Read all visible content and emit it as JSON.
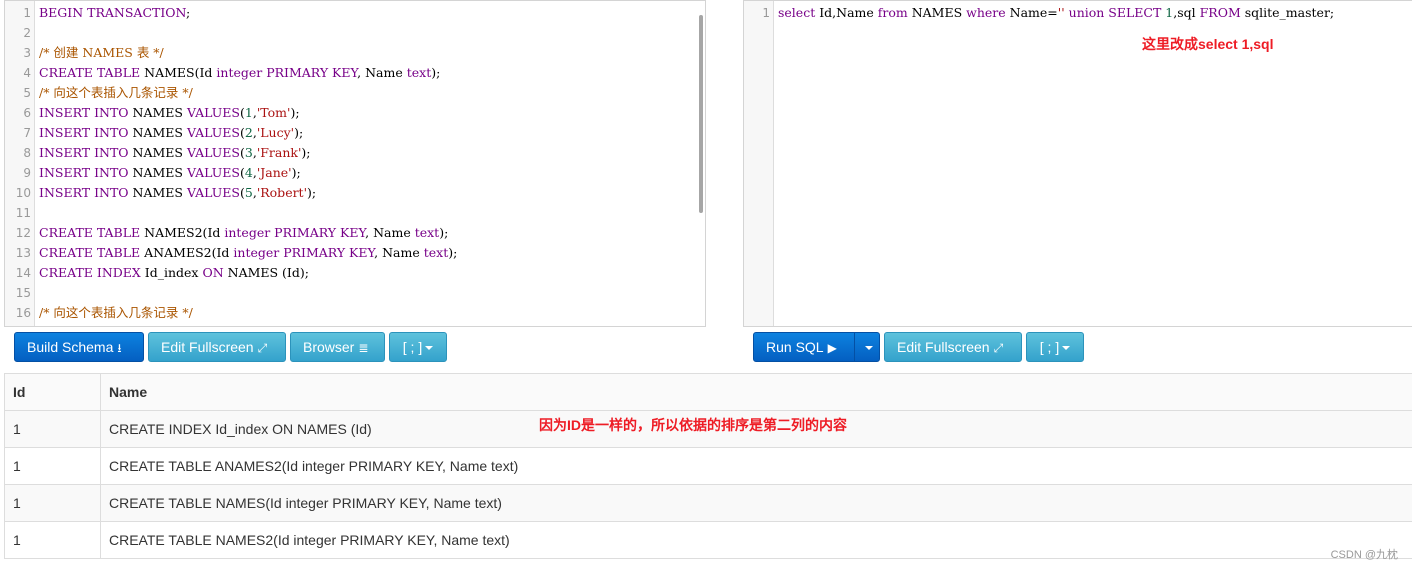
{
  "schema_editor": {
    "lines": [
      {
        "n": "1",
        "tokens": [
          [
            "kw",
            "BEGIN TRANSACTION"
          ],
          [
            "",
            ";"
          ]
        ]
      },
      {
        "n": "2",
        "tokens": []
      },
      {
        "n": "3",
        "tokens": [
          [
            "cm",
            "/* 创建 NAMES 表 */"
          ]
        ]
      },
      {
        "n": "4",
        "tokens": [
          [
            "kw",
            "CREATE TABLE "
          ],
          [
            "",
            "NAMES(Id "
          ],
          [
            "kw",
            "integer PRIMARY KEY"
          ],
          [
            "",
            ", Name "
          ],
          [
            "kw",
            "text"
          ],
          [
            "",
            ");"
          ]
        ]
      },
      {
        "n": "5",
        "tokens": [
          [
            "cm",
            "/* 向这个表插入几条记录 */"
          ]
        ]
      },
      {
        "n": "6",
        "tokens": [
          [
            "kw",
            "INSERT INTO "
          ],
          [
            "",
            "NAMES "
          ],
          [
            "kw",
            "VALUES"
          ],
          [
            "",
            "("
          ],
          [
            "num",
            "1"
          ],
          [
            "",
            ","
          ],
          [
            "str",
            "'Tom'"
          ],
          [
            "",
            ");"
          ]
        ]
      },
      {
        "n": "7",
        "tokens": [
          [
            "kw",
            "INSERT INTO "
          ],
          [
            "",
            "NAMES "
          ],
          [
            "kw",
            "VALUES"
          ],
          [
            "",
            "("
          ],
          [
            "num",
            "2"
          ],
          [
            "",
            ","
          ],
          [
            "str",
            "'Lucy'"
          ],
          [
            "",
            ");"
          ]
        ]
      },
      {
        "n": "8",
        "tokens": [
          [
            "kw",
            "INSERT INTO "
          ],
          [
            "",
            "NAMES "
          ],
          [
            "kw",
            "VALUES"
          ],
          [
            "",
            "("
          ],
          [
            "num",
            "3"
          ],
          [
            "",
            ","
          ],
          [
            "str",
            "'Frank'"
          ],
          [
            "",
            ");"
          ]
        ]
      },
      {
        "n": "9",
        "tokens": [
          [
            "kw",
            "INSERT INTO "
          ],
          [
            "",
            "NAMES "
          ],
          [
            "kw",
            "VALUES"
          ],
          [
            "",
            "("
          ],
          [
            "num",
            "4"
          ],
          [
            "",
            ","
          ],
          [
            "str",
            "'Jane'"
          ],
          [
            "",
            ");"
          ]
        ]
      },
      {
        "n": "10",
        "tokens": [
          [
            "kw",
            "INSERT INTO "
          ],
          [
            "",
            "NAMES "
          ],
          [
            "kw",
            "VALUES"
          ],
          [
            "",
            "("
          ],
          [
            "num",
            "5"
          ],
          [
            "",
            ","
          ],
          [
            "str",
            "'Robert'"
          ],
          [
            "",
            ");"
          ]
        ]
      },
      {
        "n": "11",
        "tokens": []
      },
      {
        "n": "12",
        "tokens": [
          [
            "kw",
            "CREATE TABLE "
          ],
          [
            "",
            "NAMES2(Id "
          ],
          [
            "kw",
            "integer PRIMARY KEY"
          ],
          [
            "",
            ", Name "
          ],
          [
            "kw",
            "text"
          ],
          [
            "",
            ");"
          ]
        ]
      },
      {
        "n": "13",
        "tokens": [
          [
            "kw",
            "CREATE TABLE "
          ],
          [
            "",
            "ANAMES2(Id "
          ],
          [
            "kw",
            "integer PRIMARY KEY"
          ],
          [
            "",
            ", Name "
          ],
          [
            "kw",
            "text"
          ],
          [
            "",
            ");"
          ]
        ]
      },
      {
        "n": "14",
        "tokens": [
          [
            "kw",
            "CREATE INDEX "
          ],
          [
            "",
            "Id_index "
          ],
          [
            "kw",
            "ON "
          ],
          [
            "",
            "NAMES (Id);"
          ]
        ]
      },
      {
        "n": "15",
        "tokens": []
      },
      {
        "n": "16",
        "tokens": [
          [
            "cm",
            "/* 向这个表插入几条记录 */"
          ]
        ]
      }
    ]
  },
  "query_editor": {
    "lines": [
      {
        "n": "1",
        "tokens": [
          [
            "kw",
            "select "
          ],
          [
            "",
            "Id,Name "
          ],
          [
            "kw",
            "from "
          ],
          [
            "",
            "NAMES "
          ],
          [
            "kw",
            "where "
          ],
          [
            "",
            "Name="
          ],
          [
            "str",
            "''"
          ],
          [
            "",
            " "
          ],
          [
            "kw",
            "union SELECT "
          ],
          [
            "num",
            "1"
          ],
          [
            "",
            ",sql "
          ],
          [
            "kw",
            "FROM "
          ],
          [
            "",
            "sqlite_master;"
          ]
        ]
      }
    ]
  },
  "notes": {
    "query": "这里改成select 1,sql",
    "result": "因为ID是一样的，所以依据的排序是第二列的内容"
  },
  "buttons": {
    "build_schema": "Build Schema",
    "edit_fullscreen": "Edit Fullscreen",
    "browser": "Browser",
    "delimiter": "[ ; ]",
    "run_sql": "Run SQL"
  },
  "icons": {
    "build_schema": "download-icon",
    "edit_fullscreen": "expand-icon",
    "browser": "tree-icon",
    "run_sql": "play-icon"
  },
  "results": {
    "headers": [
      "Id",
      "Name"
    ],
    "rows": [
      [
        "1",
        "CREATE INDEX Id_index ON NAMES (Id)"
      ],
      [
        "1",
        "CREATE TABLE ANAMES2(Id integer PRIMARY KEY, Name text)"
      ],
      [
        "1",
        "CREATE TABLE NAMES(Id integer PRIMARY KEY, Name text)"
      ],
      [
        "1",
        "CREATE TABLE NAMES2(Id integer PRIMARY KEY, Name text)"
      ]
    ]
  },
  "watermark": "CSDN @九枕",
  "colors": {
    "primary_button": "#045fc1",
    "info_button": "#34a2cc",
    "annotation": "#ee1c25",
    "keyword": "#770088",
    "comment": "#aa5500",
    "string": "#aa1111",
    "number": "#116644"
  }
}
